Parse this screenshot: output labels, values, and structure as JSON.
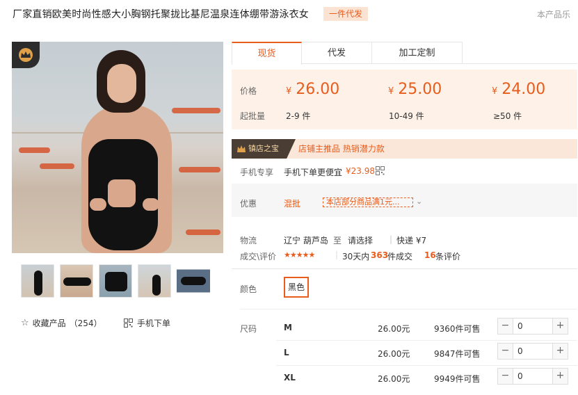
{
  "title": "厂家直销欧美时尚性感大小胸钢托聚拢比基尼温泉连体绷带游泳衣女",
  "title_badge": "一件代发",
  "top_right_tip": "本产品乐",
  "favorite": {
    "label": "收藏产品",
    "count": "（254）"
  },
  "mobile_order": {
    "label": "手机下单"
  },
  "tabs": [
    {
      "label": "现货",
      "active": true
    },
    {
      "label": "代发",
      "active": false
    },
    {
      "label": "加工定制",
      "active": false
    }
  ],
  "price_box": {
    "price_label": "价格",
    "moq_label": "起批量",
    "currency": "¥",
    "tiers": [
      {
        "price": "26.00",
        "qty": "2-9 件"
      },
      {
        "price": "25.00",
        "qty": "10-49 件"
      },
      {
        "price": "24.00",
        "qty": "≥50 件"
      }
    ]
  },
  "treasure": {
    "tag": "镇店之宝",
    "text": "店铺主推品  热销潜力款"
  },
  "mobile_exclusive": {
    "label": "手机专享",
    "text": "手机下单更便宜",
    "price": "¥23.98"
  },
  "promo": {
    "label": "优惠",
    "type": "混批",
    "text": "本店部分商品满1元..."
  },
  "logistics": {
    "label": "物流",
    "origin": "辽宁 葫芦岛",
    "to": "至",
    "select": "请选择",
    "divider": "|",
    "express": "快递 ¥7"
  },
  "deals": {
    "label": "成交\\评价",
    "stars": "★★★★★",
    "prefix": "30天内",
    "count": "363",
    "suffix": "件成交",
    "reviews": "16",
    "reviews_suffix": "条评价"
  },
  "color": {
    "label": "颜色",
    "option": "黑色"
  },
  "sizes": {
    "label": "尺码",
    "rows": [
      {
        "name": "M",
        "price": "26.00元",
        "stock": "9360件可售",
        "qty": "0"
      },
      {
        "name": "L",
        "price": "26.00元",
        "stock": "9847件可售",
        "qty": "0"
      },
      {
        "name": "XL",
        "price": "26.00元",
        "stock": "9949件可售",
        "qty": "0"
      }
    ]
  },
  "stepper": {
    "minus": "−",
    "plus": "+"
  },
  "colors": {
    "accent": "#e85c1c",
    "price_bg": "#fdf1e8",
    "badge_bg": "#fbe3d4"
  }
}
